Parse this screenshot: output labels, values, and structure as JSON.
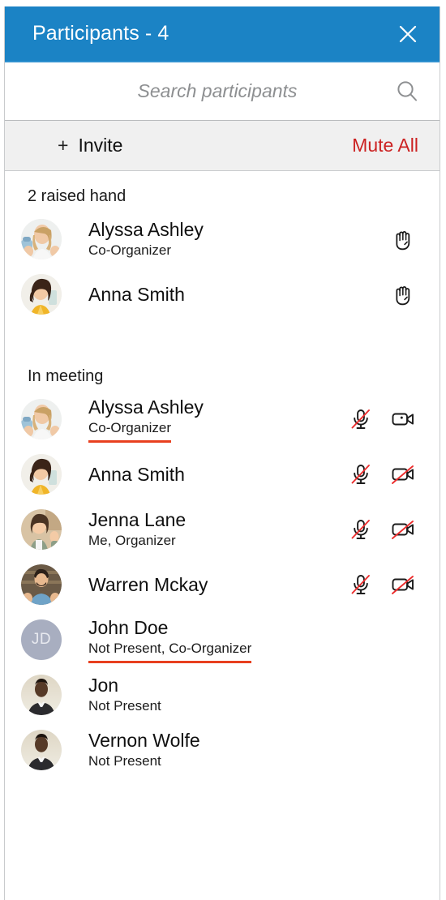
{
  "window": {
    "title": "Participants - 4",
    "close_icon": "close-icon",
    "header_bg": "#1b83c5"
  },
  "search": {
    "placeholder": "Search participants",
    "value": "",
    "icon": "search-icon"
  },
  "toolbar": {
    "invite_plus": "+",
    "invite_label": "Invite",
    "mute_all_label": "Mute All",
    "mute_all_color": "#cc2222"
  },
  "sections": [
    {
      "id": "raised-hand",
      "header": "2 raised hand",
      "participants": [
        {
          "name": "Alyssa Ashley",
          "subtitle": "Co-Organizer",
          "subtitle_underlined": false,
          "avatar": "photo-woman-blonde",
          "initials": "",
          "icons": [
            "raised-hand-icon"
          ]
        },
        {
          "name": "Anna Smith",
          "subtitle": "",
          "subtitle_underlined": false,
          "avatar": "photo-woman-yellow",
          "initials": "",
          "icons": [
            "raised-hand-icon"
          ]
        }
      ]
    },
    {
      "id": "in-meeting",
      "header": "In meeting",
      "participants": [
        {
          "name": "Alyssa Ashley",
          "subtitle": "Co-Organizer",
          "subtitle_underlined": true,
          "avatar": "photo-woman-blonde",
          "initials": "",
          "icons": [
            "microphone-muted-icon",
            "camera-on-icon"
          ]
        },
        {
          "name": "Anna Smith",
          "subtitle": "",
          "subtitle_underlined": false,
          "avatar": "photo-woman-yellow",
          "initials": "",
          "icons": [
            "microphone-muted-icon",
            "camera-off-icon"
          ]
        },
        {
          "name": "Jenna Lane",
          "subtitle": "Me, Organizer",
          "subtitle_underlined": false,
          "avatar": "photo-woman-green",
          "initials": "",
          "icons": [
            "microphone-muted-icon",
            "camera-off-icon"
          ]
        },
        {
          "name": "Warren Mckay",
          "subtitle": "",
          "subtitle_underlined": false,
          "avatar": "photo-man-blue",
          "initials": "",
          "icons": [
            "microphone-muted-icon",
            "camera-off-icon"
          ]
        },
        {
          "name": "John Doe",
          "subtitle": "Not Present, Co-Organizer",
          "subtitle_underlined": true,
          "avatar": "initials-avatar",
          "initials": "JD",
          "icons": []
        },
        {
          "name": "Jon",
          "subtitle": "Not Present",
          "subtitle_underlined": false,
          "avatar": "photo-man-suit",
          "initials": "",
          "icons": []
        },
        {
          "name": "Vernon Wolfe",
          "subtitle": "Not Present",
          "subtitle_underlined": false,
          "avatar": "photo-man-suit",
          "initials": "",
          "icons": []
        }
      ]
    }
  ],
  "colors": {
    "accent_blue": "#1b83c5",
    "alert_red": "#cc2222",
    "underline_orange": "#e8401f",
    "slash_red": "#ec2d2d",
    "initials_avatar_bg": "#a8aec0"
  }
}
